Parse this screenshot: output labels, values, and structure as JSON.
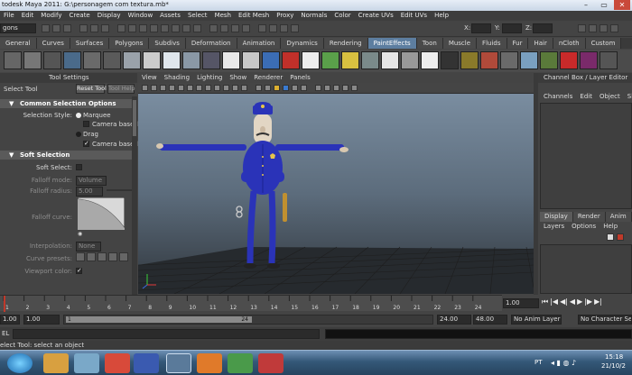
{
  "window": {
    "title": "todesk Maya 2011: G:\\personagem com textura.mb*",
    "controls": [
      "–",
      "▭",
      "✕"
    ]
  },
  "menubar": [
    "File",
    "Edit",
    "Modify",
    "Create",
    "Display",
    "Window",
    "Assets",
    "Select",
    "Mesh",
    "Edit Mesh",
    "Proxy",
    "Normals",
    "Color",
    "Create UVs",
    "Edit UVs",
    "Help"
  ],
  "statusline": {
    "menuset": "gons",
    "coord_labels": [
      "X:",
      "Y:",
      "Z:"
    ]
  },
  "shelf_tabs": {
    "items": [
      "General",
      "Curves",
      "Surfaces",
      "Polygons",
      "Subdivs",
      "Deformation",
      "Animation",
      "Dynamics",
      "Rendering",
      "PaintEffects",
      "Toon",
      "Muscle",
      "Fluids",
      "Fur",
      "Hair",
      "nCloth",
      "Custom"
    ],
    "active": "PaintEffects"
  },
  "tool_settings": {
    "panel_title": "Tool Settings",
    "tool_name": "Select Tool",
    "reset_button": "Reset Tool",
    "help_button": "Tool Help",
    "common_section": "Common Selection Options",
    "selection_style_label": "Selection Style:",
    "marquee": "Marquee",
    "camera_based_1": "Camera based",
    "drag": "Drag",
    "camera_based_2": "Camera based",
    "soft_section": "Soft Selection",
    "soft_select_label": "Soft Select:",
    "falloff_mode_label": "Falloff mode:",
    "falloff_mode_value": "Volume",
    "falloff_radius_label": "Falloff radius:",
    "falloff_radius_value": "5.00",
    "falloff_curve_label": "Falloff curve:",
    "interpolation_label": "Interpolation:",
    "interpolation_value": "None",
    "curve_presets_label": "Curve presets:",
    "viewport_color_label": "Viewport color:"
  },
  "viewport": {
    "menu": [
      "View",
      "Shading",
      "Lighting",
      "Show",
      "Renderer",
      "Panels"
    ]
  },
  "channel_box": {
    "title": "Channel Box / Layer Editor",
    "menu": [
      "Channels",
      "Edit",
      "Object",
      "Show"
    ],
    "layer_tabs": [
      "Display",
      "Render",
      "Anim"
    ],
    "layer_menu": [
      "Layers",
      "Options",
      "Help"
    ]
  },
  "time_slider": {
    "ticks": [
      "1",
      "2",
      "3",
      "4",
      "5",
      "6",
      "7",
      "8",
      "9",
      "10",
      "11",
      "12",
      "13",
      "14",
      "15",
      "16",
      "17",
      "18",
      "19",
      "20",
      "21",
      "22",
      "23",
      "24"
    ],
    "current_frame": "1.00",
    "current_time_value": 1
  },
  "range_slider": {
    "start_time": "1.00",
    "range_start": "1.00",
    "range_start_marker": "1",
    "range_end_marker": "24",
    "range_end": "24.00",
    "end_time": "48.00",
    "anim_layer": "No Anim Layer",
    "character_set": "No Character Set"
  },
  "command_line": {
    "label": "EL"
  },
  "help_line": {
    "text": "elect Tool: select an object"
  },
  "taskbar": {
    "language": "PT",
    "time": "15:18",
    "date": "21/10/2"
  },
  "colors": {
    "active_tab": "#5d7ea0",
    "ui_bg": "#444444",
    "timeline_marker": "#c0392b"
  }
}
